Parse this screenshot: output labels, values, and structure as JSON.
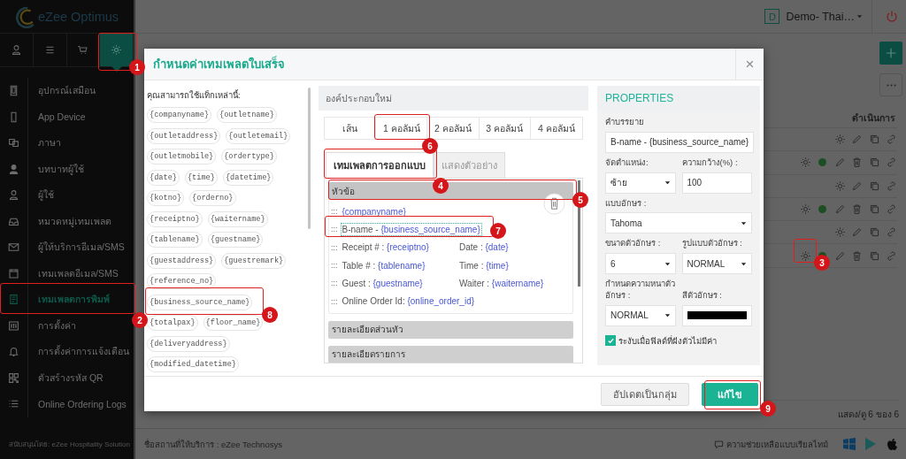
{
  "app": {
    "logo": "eZee Optimus",
    "user_initial": "D",
    "user_name": "Demo- Thai…"
  },
  "sidebar": {
    "tabs": [
      {
        "selected": false
      },
      {
        "selected": false
      },
      {
        "selected": false
      },
      {
        "selected": true
      }
    ],
    "items": [
      {
        "label": "อุปกรณ์เสมือน",
        "selected": false
      },
      {
        "label": "App Device",
        "selected": false
      },
      {
        "label": "ภาษา",
        "selected": false
      },
      {
        "label": "บทบาทผู้ใช้",
        "selected": false
      },
      {
        "label": "ผู้ใช้",
        "selected": false
      },
      {
        "label": "หมวดหมู่เทมเพลต",
        "selected": false
      },
      {
        "label": "ผู้ให้บริการอีเมล/SMS",
        "selected": false
      },
      {
        "label": "เทมเพลตอีเมล/SMS",
        "selected": false
      },
      {
        "label": "เทมเพลตการพิมพ์",
        "selected": true
      },
      {
        "label": "การตั้งค่า",
        "selected": false
      },
      {
        "label": "การตั้งค่าการแจ้งเตือน",
        "selected": false
      },
      {
        "label": "ตัวสร้างรหัส QR",
        "selected": false
      },
      {
        "label": "Online Ordering Logs",
        "selected": false
      }
    ],
    "footer": "สนับสนุนโดย: eZee Hospitality Solution"
  },
  "page": {
    "column_header": "ดำเนินการ",
    "rows": [
      {
        "kind": "basic"
      },
      {
        "kind": "with-status"
      },
      {
        "kind": "basic"
      },
      {
        "kind": "with-status"
      },
      {
        "kind": "basic"
      },
      {
        "kind": "with-status"
      }
    ],
    "pager": "แสดง/ดู 6 ของ 6"
  },
  "status_bar": {
    "venue": "ชื่อสถานที่ให้บริการ : eZee Technosys",
    "help": "ความช่วยเหลือแบบเรียลไทม์"
  },
  "dialog": {
    "title": "กำหนดค่าเทมเพลตใบเสร็จ",
    "close": "×",
    "tags_label": "คุณสามารถใช้แท็กเหล่านี้:",
    "tags": [
      "{companyname}",
      "{outletname}",
      "{outletaddress}",
      "{outletemail}",
      "{outletmobile}",
      "{ordertype}",
      "{date}",
      "{time}",
      "{datetime}",
      "{kotno}",
      "{orderno}",
      "{receiptno}",
      "{waitername}",
      "{tablename}",
      "{guestname}",
      "{guestaddress}",
      "{guestremark}",
      "{reference_no}",
      "{business_source_name}",
      "{totalpax}",
      "{floor_name}",
      "{deliveryaddress}",
      "{modified_datetime}"
    ],
    "new_element": {
      "title": "องค์ประกอบใหม่",
      "layouts": [
        {
          "label": "เส้น",
          "selected": false
        },
        {
          "label": "1 คอลัมน์",
          "selected": false
        },
        {
          "label": "2 คอลัมน์",
          "selected": false
        },
        {
          "label": "3 คอลัมน์",
          "selected": false
        },
        {
          "label": "4 คอลัมน์",
          "selected": false
        }
      ]
    },
    "editor_tabs": [
      {
        "label": "เทมเพลตการออกแบบ",
        "selected": true
      },
      {
        "label": "แสดงตัวอย่าง",
        "selected": false
      }
    ],
    "sections": [
      {
        "title": "หัวข้อ",
        "expanded": true,
        "rows": [
          {
            "handle": ":::",
            "selected": false,
            "cells": [
              {
                "tag": "{companyname}"
              }
            ]
          },
          {
            "handle": ":::",
            "selected": true,
            "cells": [
              {
                "label": "B-name - ",
                "tag": "{business_source_name}"
              }
            ]
          },
          {
            "handle": ":::",
            "selected": false,
            "cells": [
              {
                "label": "Receipt # : ",
                "tag": "{receiptno}"
              },
              {
                "label": "Date : ",
                "tag": "{date}"
              }
            ]
          },
          {
            "handle": ":::",
            "selected": false,
            "cells": [
              {
                "label": "Table # : ",
                "tag": "{tablename}"
              },
              {
                "label": "Time : ",
                "tag": "{time}"
              }
            ]
          },
          {
            "handle": ":::",
            "selected": false,
            "cells": [
              {
                "label": "Guest : ",
                "tag": "{guestname}"
              },
              {
                "label": "Waiter : ",
                "tag": "{waitername}"
              }
            ]
          },
          {
            "handle": ":::",
            "selected": false,
            "cells": [
              {
                "label": "Online Order Id: ",
                "tag": "{online_order_id}"
              }
            ]
          }
        ]
      },
      {
        "title": "รายละเอียดส่วนหัว",
        "expanded": false
      },
      {
        "title": "รายละเอียดรายการ",
        "expanded": false
      }
    ],
    "properties": {
      "title": "PROPERTIES",
      "rows": [
        [
          {
            "kind": "text",
            "label": "คำบรรยาย",
            "value": "B-name - {business_source_name}"
          }
        ],
        [
          {
            "kind": "select",
            "label": "จัดตำแหน่ง:",
            "value": "ซ้าย"
          },
          {
            "kind": "text",
            "label": "ความกว้าง(%) :",
            "value": "100"
          }
        ],
        [
          {
            "kind": "select",
            "label": "แบบอักษร :",
            "value": "Tahoma"
          }
        ],
        [
          {
            "kind": "select",
            "label": "ขนาดตัวอักษร :",
            "value": "6"
          },
          {
            "kind": "select",
            "label": "รูปแบบตัวอักษร :",
            "value": "NORMAL"
          }
        ],
        [
          {
            "kind": "select",
            "label": "กำหนดความหนาตัวอักษร :",
            "value": "NORMAL"
          },
          {
            "kind": "color",
            "label": "สีตัวอักษร :"
          }
        ]
      ],
      "checkbox": {
        "label": "ระงับเมื่อฟิลด์ที่ฝังตัวไม่มีค่า",
        "checked": true
      }
    },
    "buttons": [
      {
        "kind": "secondary",
        "label": "อัปเดตเป็นกลุ่ม"
      },
      {
        "kind": "primary",
        "label": "แก้ไข"
      }
    ]
  },
  "annotations": [
    {
      "number": "1"
    },
    {
      "number": "2"
    },
    {
      "number": "3"
    },
    {
      "number": "4"
    },
    {
      "number": "5"
    },
    {
      "number": "6"
    },
    {
      "number": "7"
    },
    {
      "number": "8"
    },
    {
      "number": "9"
    }
  ]
}
